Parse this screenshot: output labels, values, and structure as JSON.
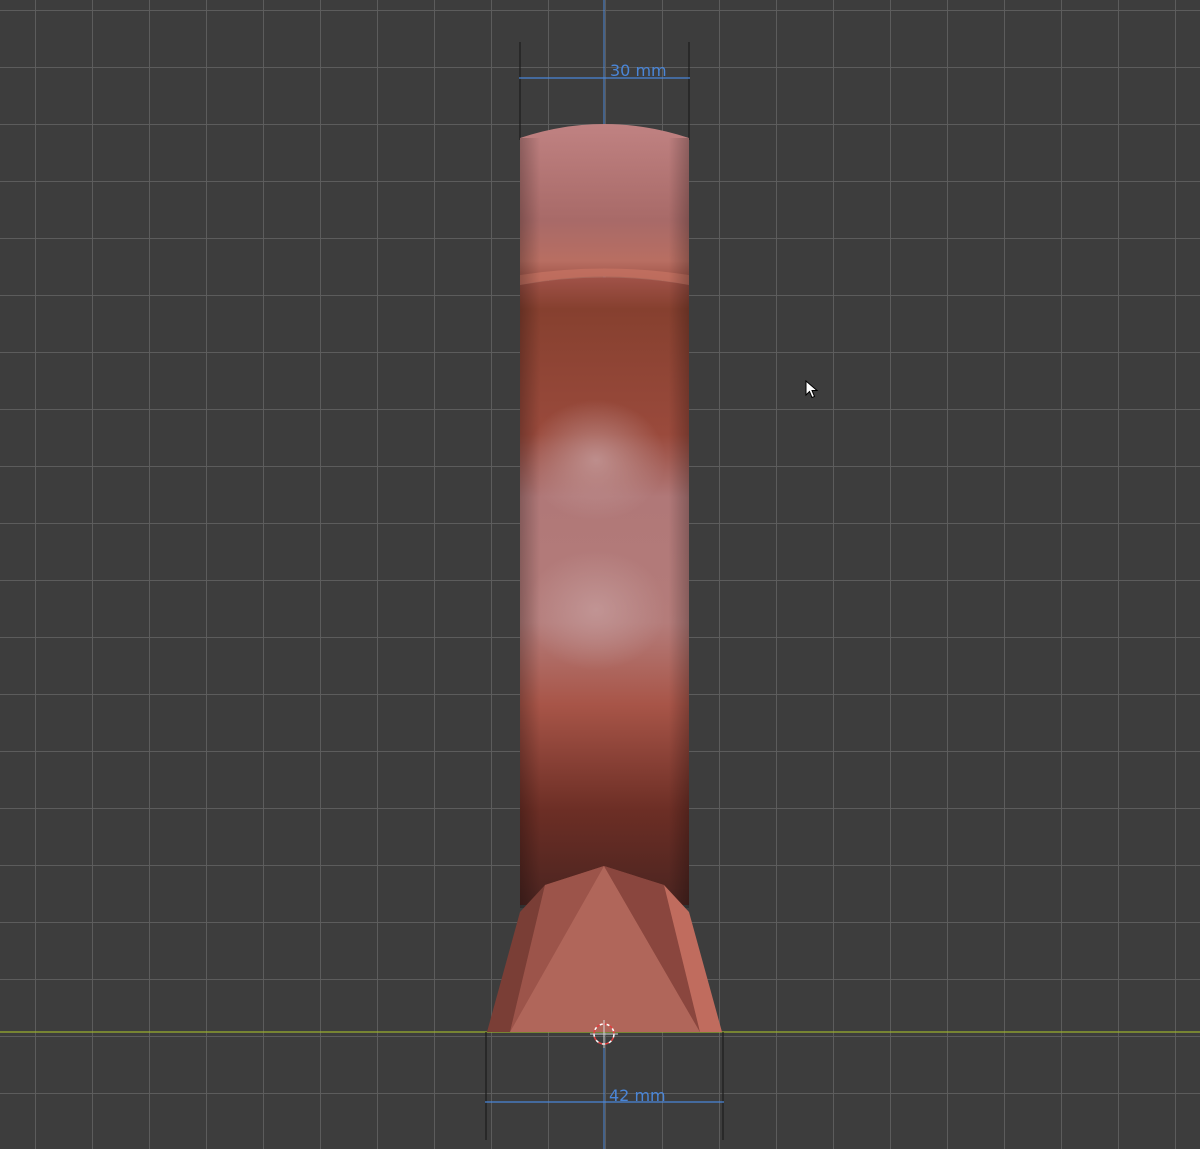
{
  "viewport": {
    "background_color": "#3d3d3d",
    "grid_color": "#5f5f5f",
    "x_axis_color": "#9ab02e",
    "z_axis_color": "#4a86d8"
  },
  "model": {
    "color_light": "#b87878",
    "color_mid": "#8a3c30",
    "color_dark": "#4f2420"
  },
  "measurements": {
    "top_width_label": "30 mm",
    "bottom_width_label": "42 mm"
  },
  "icons": {
    "origin": "3d-cursor-icon",
    "pointer": "mouse-pointer-icon"
  }
}
